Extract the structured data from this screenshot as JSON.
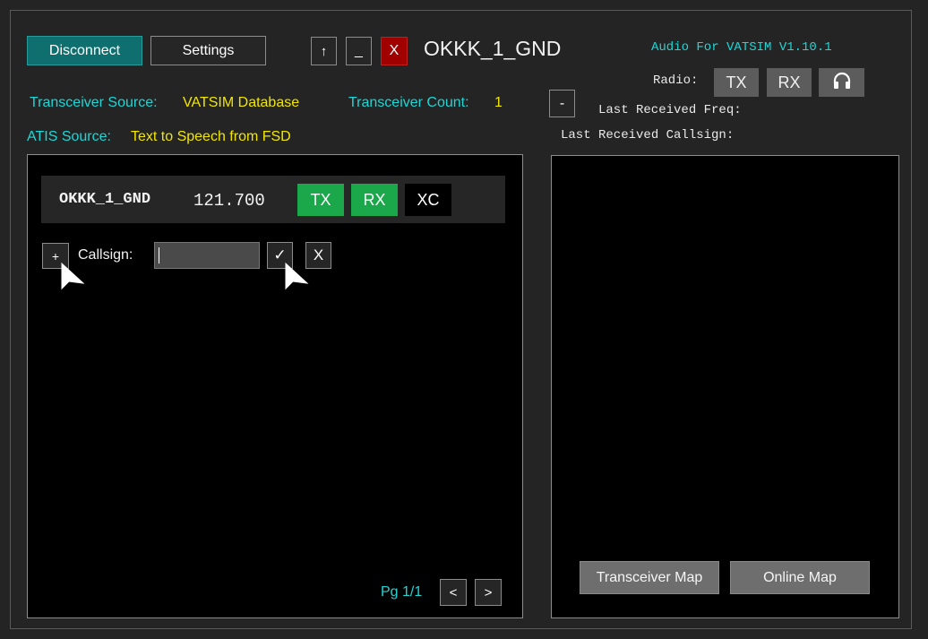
{
  "header": {
    "disconnect_label": "Disconnect",
    "settings_label": "Settings",
    "up_label": "↑",
    "minimize_label": "_",
    "close_label": "X",
    "callsign_title": "OKKK_1_GND",
    "version_label": "Audio For VATSIM V1.10.1"
  },
  "radio": {
    "label": "Radio:",
    "tx_label": "TX",
    "rx_label": "RX",
    "headset_icon": "headphones-icon"
  },
  "info": {
    "transceiver_source_label": "Transceiver Source:",
    "transceiver_source_value": "VATSIM Database",
    "transceiver_count_label": "Transceiver Count:",
    "transceiver_count_value": "1",
    "atis_source_label": "ATIS Source:",
    "atis_source_value": "Text to Speech from FSD",
    "collapse_label": "-",
    "last_freq_label": "Last Received Freq:",
    "last_callsign_label": "Last Received Callsign:"
  },
  "station": {
    "callsign": "OKKK_1_GND",
    "frequency": "121.700",
    "tx_label": "TX",
    "rx_label": "RX",
    "xc_label": "XC"
  },
  "add_station": {
    "plus_label": "+",
    "callsign_label": "Callsign:",
    "input_value": "",
    "confirm_label": "✓",
    "cancel_label": "X"
  },
  "pager": {
    "page_label": "Pg 1/1",
    "prev_label": "<",
    "next_label": ">"
  },
  "right_panel": {
    "transceiver_map_label": "Transceiver Map",
    "online_map_label": "Online Map"
  },
  "colors": {
    "accent_teal": "#0f6f6f",
    "tx_rx_active": "#1aa84a",
    "close_red": "#a00000",
    "cyan_text": "#1fd6d6",
    "yellow_text": "#f2e600"
  }
}
